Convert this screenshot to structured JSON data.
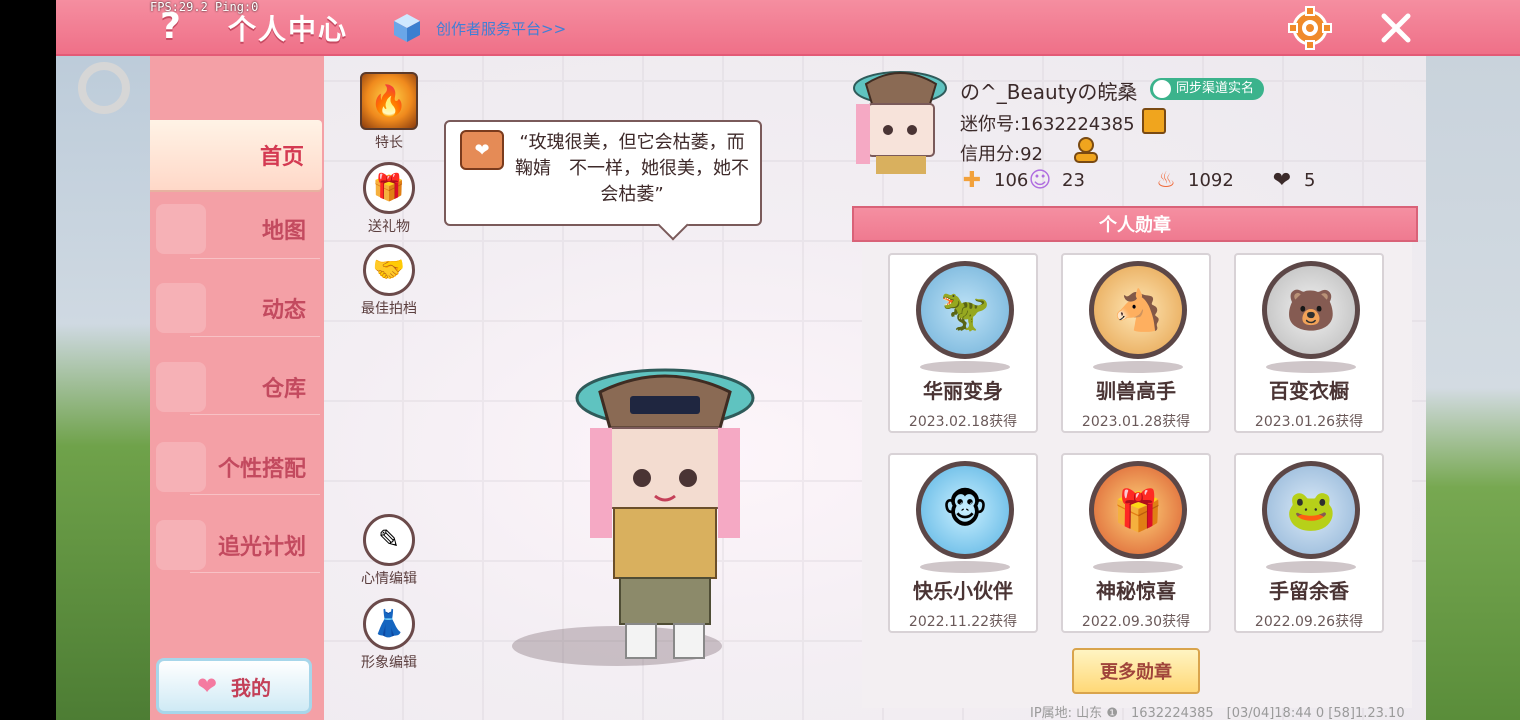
{
  "debug": {
    "fps": "FPS:29.2",
    "ping": "Ping:0"
  },
  "header": {
    "help_symbol": "?",
    "title": "个人中心",
    "creator_link": "创作者服务平台>>"
  },
  "nav": {
    "items": [
      {
        "label": "首页",
        "active": true
      },
      {
        "label": "地图"
      },
      {
        "label": "动态"
      },
      {
        "label": "仓库"
      },
      {
        "label": "个性搭配"
      },
      {
        "label": "追光计划"
      }
    ],
    "my_label": "我的"
  },
  "actions": {
    "specialty": "特长",
    "gift": "送礼物",
    "partner": "最佳拍档",
    "mood_edit": "心情编辑",
    "look_edit": "形象编辑"
  },
  "bubble": {
    "text": "“玫瑰很美，但它会枯萎，而鞠婧　不一样，她很美，她不会枯萎”"
  },
  "profile": {
    "name": "の^_Beautyの皖桑",
    "verify_label": "同步渠道实名",
    "mini_id": "迷你号:1632224385",
    "credit": "信用分:92",
    "stats": [
      {
        "icon": "plus-card-icon",
        "value": "106"
      },
      {
        "icon": "fans-icon",
        "value": "23"
      },
      {
        "icon": "flame-icon",
        "value": "1092"
      },
      {
        "icon": "heart-icon",
        "value": "5"
      }
    ]
  },
  "medals": {
    "header": "个人勋章",
    "items": [
      {
        "name": "华丽变身",
        "date": "2023.02.18获得",
        "color": "#6fb0d8"
      },
      {
        "name": "驯兽高手",
        "date": "2023.01.28获得",
        "color": "#e4a04a"
      },
      {
        "name": "百变衣橱",
        "date": "2023.01.26获得",
        "color": "#b9b9b9"
      },
      {
        "name": "快乐小伙伴",
        "date": "2022.11.22获得",
        "color": "#57b2e2"
      },
      {
        "name": "神秘惊喜",
        "date": "2022.09.30获得",
        "color": "#d9592f"
      },
      {
        "name": "手留余香",
        "date": "2022.09.26获得",
        "color": "#8fb3d6"
      }
    ],
    "more_label": "更多勋章"
  },
  "footer": {
    "text": "IP属地: 山东 ❶　1632224385　[03/04]18:44 0 [58]1.23.10"
  },
  "colors": {
    "accent": "#ef7a90",
    "nav_bg": "#f4a0a6",
    "text_dark": "#3b2a2a"
  }
}
